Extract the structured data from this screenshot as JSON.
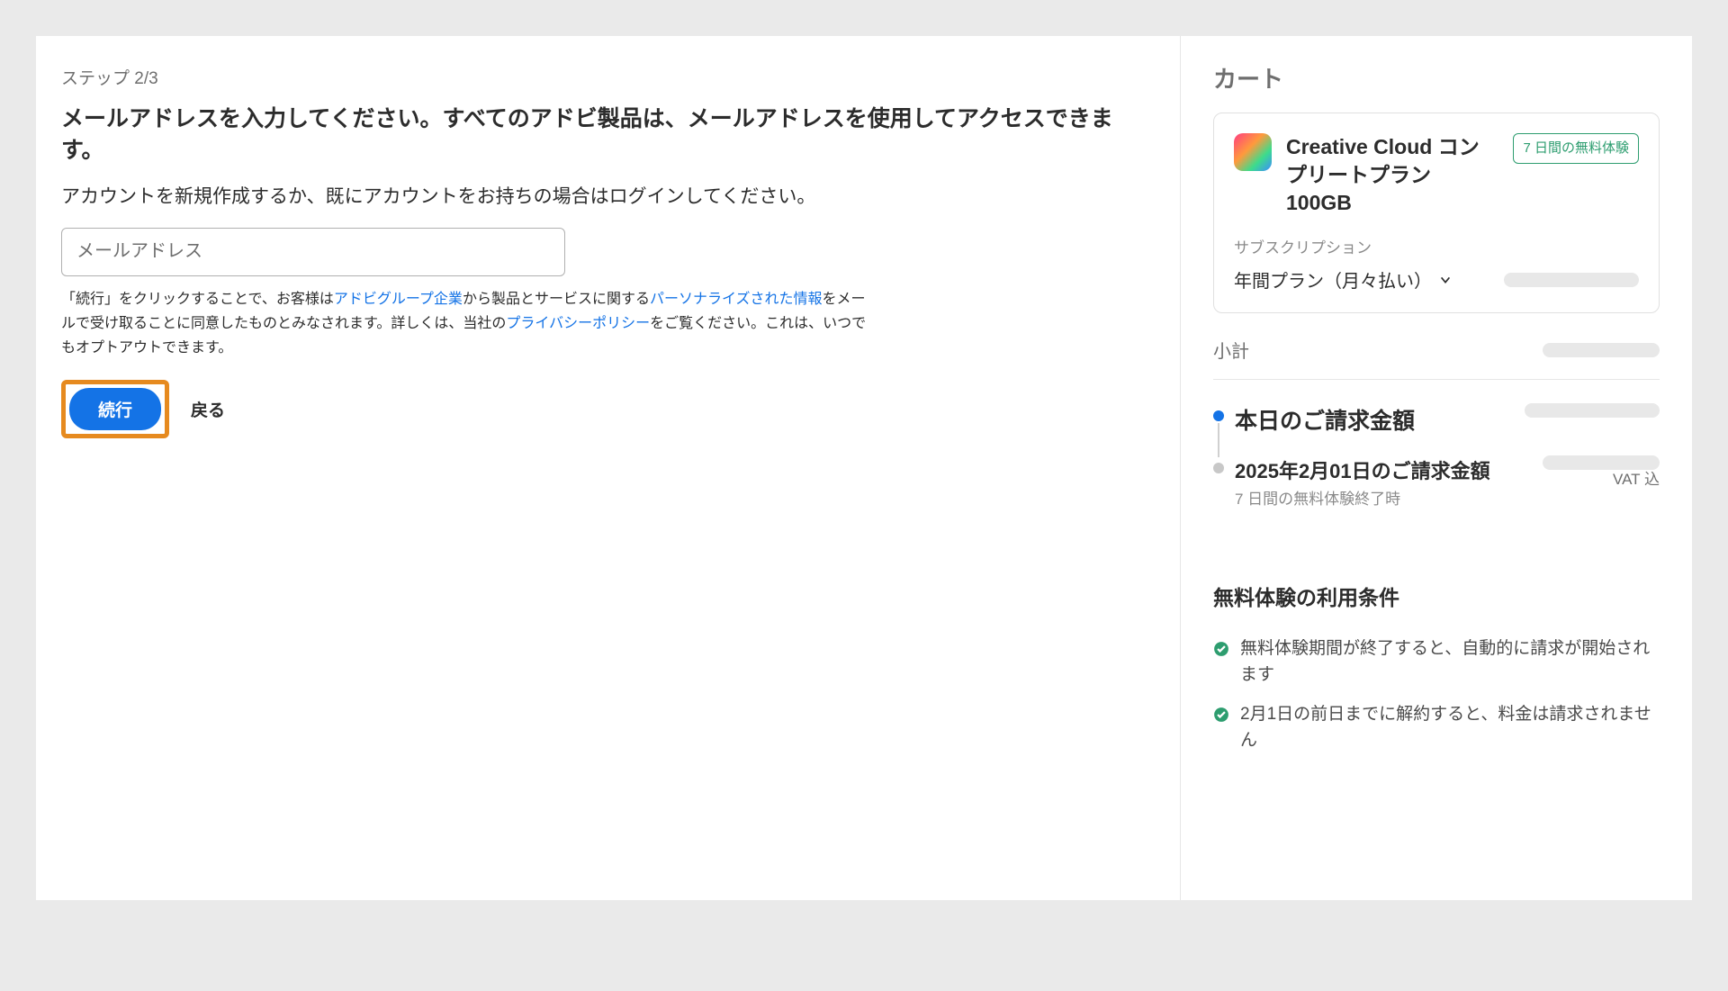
{
  "main": {
    "step": "ステップ 2/3",
    "title": "メールアドレスを入力してください。すべてのアドビ製品は、メールアドレスを使用してアクセスできます。",
    "subtitle": "アカウントを新規作成するか、既にアカウントをお持ちの場合はログインしてください。",
    "email_placeholder": "メールアドレス",
    "consent": {
      "t1": "「続行」をクリックすることで、お客様は",
      "link_group": "アドビグループ企業",
      "t2": "から製品とサービスに関する",
      "link_personalized": "パーソナライズされた情報",
      "t3": "をメールで受け取ることに同意したものとみなされます。詳しくは、当社の",
      "link_privacy": "プライバシーポリシー",
      "t4": "をご覧ください。これは、いつでもオプトアウトできます。"
    },
    "continue": "続行",
    "back": "戻る"
  },
  "cart": {
    "title": "カート",
    "product": {
      "name": "Creative Cloud コンプリートプラン 100GB",
      "trial_badge": "7 日間の無料体験"
    },
    "subscription_label": "サブスクリプション",
    "plan": "年間プラン（月々払い）",
    "subtotal_label": "小計",
    "today_label": "本日のご請求金額",
    "future_label": "2025年2月01日のご請求金額",
    "future_sub": "7 日間の無料体験終了時",
    "vat": "VAT 込",
    "terms_title": "無料体験の利用条件",
    "terms": [
      "無料体験期間が終了すると、自動的に請求が開始されます",
      "2月1日の前日までに解約すると、料金は請求されません"
    ]
  }
}
